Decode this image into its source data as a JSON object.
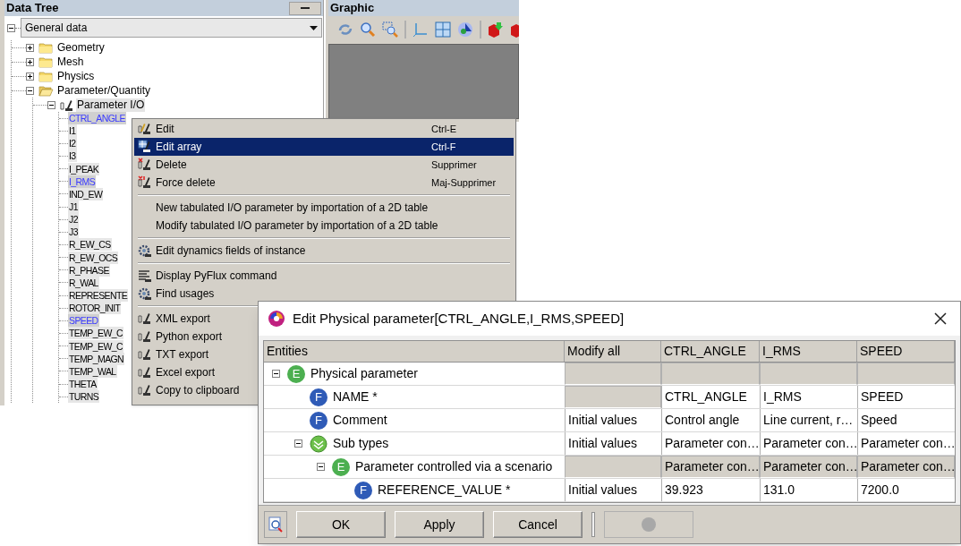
{
  "data_tree": {
    "title": "Data Tree",
    "dropdown": "General data",
    "expanded": true,
    "children": [
      {
        "label": "Geometry",
        "kind": "folder",
        "expanded": false
      },
      {
        "label": "Mesh",
        "kind": "folder",
        "expanded": false
      },
      {
        "label": "Physics",
        "kind": "folder",
        "expanded": false
      },
      {
        "label": "Parameter/Quantity",
        "kind": "folder",
        "expanded": true,
        "children": [
          {
            "label": "Parameter I/O",
            "kind": "parameter",
            "expanded": true,
            "children": [
              {
                "label": "CTRL_ANGLE",
                "selected": true
              },
              {
                "label": "I1",
                "selected": false
              },
              {
                "label": "I2",
                "selected": false
              },
              {
                "label": "I3",
                "selected": false
              },
              {
                "label": "I_PEAK",
                "selected": false
              },
              {
                "label": "I_RMS",
                "selected": true
              },
              {
                "label": "IND_EW",
                "selected": false
              },
              {
                "label": "J1",
                "selected": false
              },
              {
                "label": "J2",
                "selected": false
              },
              {
                "label": "J3",
                "selected": false
              },
              {
                "label": "R_EW_CS",
                "selected": false
              },
              {
                "label": "R_EW_OCS",
                "selected": false
              },
              {
                "label": "R_PHASE",
                "selected": false
              },
              {
                "label": "R_WAL",
                "selected": false
              },
              {
                "label": "REPRESENTE",
                "selected": false
              },
              {
                "label": "ROTOR_INIT",
                "selected": false
              },
              {
                "label": "SPEED",
                "selected": true
              },
              {
                "label": "TEMP_EW_C",
                "selected": false
              },
              {
                "label": "TEMP_EW_C",
                "selected": false
              },
              {
                "label": "TEMP_MAGN",
                "selected": false
              },
              {
                "label": "TEMP_WAL",
                "selected": false
              },
              {
                "label": "THETA",
                "selected": false
              },
              {
                "label": "TURNS",
                "selected": false
              }
            ]
          }
        ]
      }
    ]
  },
  "graphic": {
    "title": "Graphic"
  },
  "context_menu": {
    "sections": [
      [
        {
          "label": "Edit",
          "shortcut": "Ctrl-E",
          "kind": "edit",
          "selected": false
        },
        {
          "label": "Edit array",
          "shortcut": "Ctrl-F",
          "kind": "array",
          "selected": true
        },
        {
          "label": "Delete",
          "shortcut": "Supprimer",
          "kind": "delete",
          "selected": false
        },
        {
          "label": "Force delete",
          "shortcut": "Maj-Supprimer",
          "kind": "force-delete",
          "selected": false
        }
      ],
      [
        {
          "label": "New tabulated  I/O parameter by  importation of a 2D table",
          "kind": "plain",
          "selected": false
        },
        {
          "label": "Modify tabulated  I/O parameter by importation of a 2D table",
          "kind": "plain",
          "selected": false
        }
      ],
      [
        {
          "label": "Edit dynamics fields of instance",
          "kind": "gears",
          "selected": false
        }
      ],
      [
        {
          "label": "Display PyFlux command",
          "kind": "command",
          "selected": false
        },
        {
          "label": "Find usages",
          "kind": "gears",
          "selected": false
        }
      ],
      [
        {
          "label": "XML export",
          "kind": "export",
          "selected": false
        },
        {
          "label": "Python export",
          "kind": "export",
          "selected": false
        },
        {
          "label": "TXT export",
          "kind": "export",
          "selected": false
        },
        {
          "label": "Excel export",
          "kind": "export",
          "selected": false
        },
        {
          "label": "Copy to clipboard",
          "kind": "export",
          "selected": false
        }
      ]
    ]
  },
  "dialog": {
    "title": "Edit Physical parameter[CTRL_ANGLE,I_RMS,SPEED]",
    "columns": [
      "Entities",
      "Modify all",
      "CTRL_ANGLE",
      "I_RMS",
      "SPEED"
    ],
    "rows": [
      {
        "label": "Physical parameter",
        "kind": "entity",
        "badge": "E",
        "expanded": true,
        "cells": [
          {
            "disabled": true
          },
          {
            "disabled": true
          },
          {
            "disabled": true
          },
          {
            "disabled": true
          }
        ],
        "children": [
          {
            "label": "NAME *",
            "kind": "field",
            "badge": "F",
            "cells": [
              {
                "disabled": true
              },
              {
                "text": "CTRL_ANGLE",
                "disabled": false
              },
              {
                "text": "I_RMS",
                "disabled": false
              },
              {
                "text": "SPEED",
                "disabled": false
              }
            ]
          },
          {
            "label": "Comment",
            "kind": "field",
            "badge": "F",
            "cells": [
              {
                "text": "Initial values",
                "disabled": false
              },
              {
                "text": "Control angle",
                "disabled": false
              },
              {
                "text": "Line current, r…",
                "disabled": false
              },
              {
                "text": "Speed",
                "disabled": false
              }
            ]
          },
          {
            "label": "Sub types",
            "kind": "subtypes",
            "expanded": true,
            "cells": [
              {
                "text": "Initial values",
                "disabled": false
              },
              {
                "text": "Parameter con…",
                "disabled": false
              },
              {
                "text": "Parameter con…",
                "disabled": false
              },
              {
                "text": "Parameter con…",
                "disabled": false
              }
            ],
            "children": [
              {
                "label": "Parameter controlled via a scenario",
                "kind": "entity",
                "badge": "E",
                "expanded": true,
                "cells": [
                  {
                    "disabled": true
                  },
                  {
                    "text": "Parameter con…",
                    "disabled": true
                  },
                  {
                    "text": "Parameter con…",
                    "disabled": true
                  },
                  {
                    "text": "Parameter con…",
                    "disabled": true
                  }
                ],
                "children": [
                  {
                    "label": "REFERENCE_VALUE *",
                    "kind": "field",
                    "badge": "F",
                    "cells": [
                      {
                        "text": "Initial values",
                        "disabled": false
                      },
                      {
                        "text": "39.923",
                        "disabled": false
                      },
                      {
                        "text": "131.0",
                        "disabled": false
                      },
                      {
                        "text": "7200.0",
                        "disabled": false
                      }
                    ]
                  }
                ]
              }
            ]
          }
        ]
      }
    ],
    "buttons": [
      {
        "label": "OK"
      },
      {
        "label": "Apply"
      },
      {
        "label": "Cancel"
      }
    ],
    "extra_button": {
      "disabled": true
    }
  }
}
